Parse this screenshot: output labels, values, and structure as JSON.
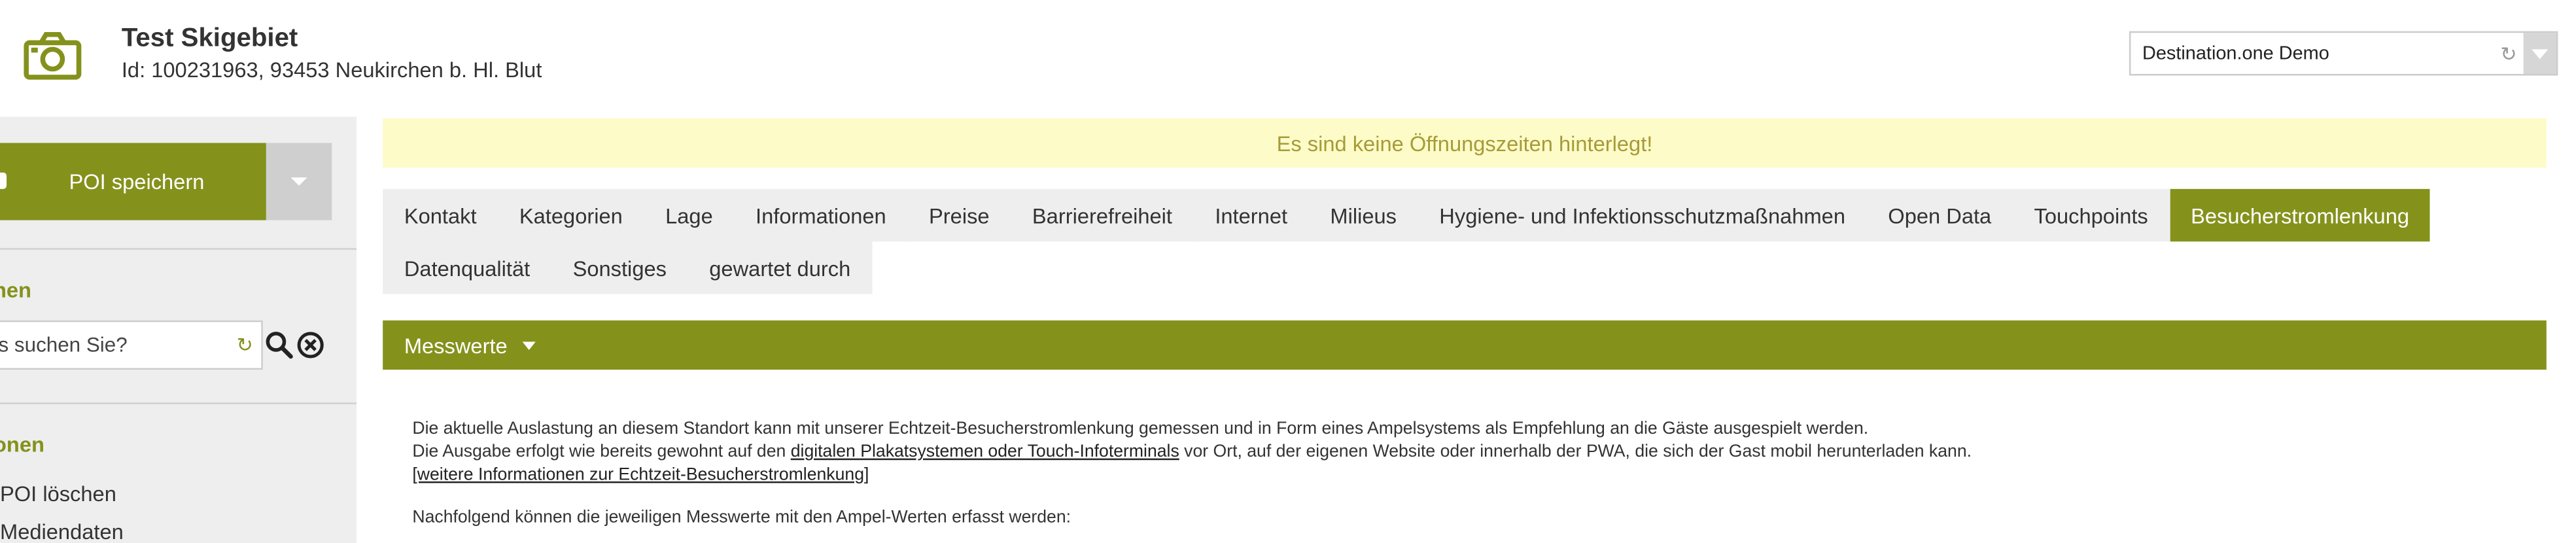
{
  "header": {
    "title": "Test Skigebiet",
    "subtitle": "Id: 100231963, 93453 Neukirchen b. Hl. Blut",
    "icon": "camera-icon"
  },
  "destination_select": {
    "value": "Destination.one Demo"
  },
  "sidebar": {
    "save_label": "POI speichern",
    "search_heading": "hen",
    "search_placeholder": "s suchen Sie?",
    "actions_heading": "onen",
    "actions": [
      {
        "label": "POI löschen"
      },
      {
        "label": "Mediendaten"
      }
    ]
  },
  "notice": {
    "text": "Es sind keine Öffnungszeiten hinterlegt!",
    "background": "#fdfcc8",
    "color": "#a69b3a"
  },
  "tabs": {
    "row1": [
      {
        "label": "Kontakt"
      },
      {
        "label": "Kategorien"
      },
      {
        "label": "Lage"
      },
      {
        "label": "Informationen"
      },
      {
        "label": "Preise"
      },
      {
        "label": "Barrierefreiheit"
      },
      {
        "label": "Internet"
      },
      {
        "label": "Milieus"
      },
      {
        "label": "Hygiene- und Infektionsschutzmaßnahmen"
      },
      {
        "label": "Open Data"
      },
      {
        "label": "Touchpoints"
      },
      {
        "label": "Besucherstromlenkung",
        "active": true
      }
    ],
    "row2": [
      {
        "label": "Datenqualität"
      },
      {
        "label": "Sonstiges"
      },
      {
        "label": "gewartet durch"
      }
    ]
  },
  "panel": {
    "title": "Messwerte",
    "line1": "Die aktuelle Auslastung an diesem Standort kann mit unserer Echtzeit-Besucherstromlenkung gemessen und in Form eines Ampelsystems als Empfehlung an die Gäste ausgespielt werden.",
    "line2_before": "Die Ausgabe erfolgt wie bereits gewohnt auf den ",
    "line2_link": "digitalen Plakatsystemen oder Touch-Infoterminals",
    "line2_after": " vor Ort, auf der eigenen Website oder innerhalb der PWA, die sich der Gast mobil herunterladen kann.",
    "more_link": "[weitere Informationen zur Echtzeit-Besucherstromlenkung]",
    "line3": "Nachfolgend können die jeweiligen Messwerte mit den Ampel-Werten erfasst werden:"
  },
  "colors": {
    "accent": "#84921c",
    "tab_bg": "#eeeeee",
    "sidebar_bg": "#eeeeee"
  }
}
